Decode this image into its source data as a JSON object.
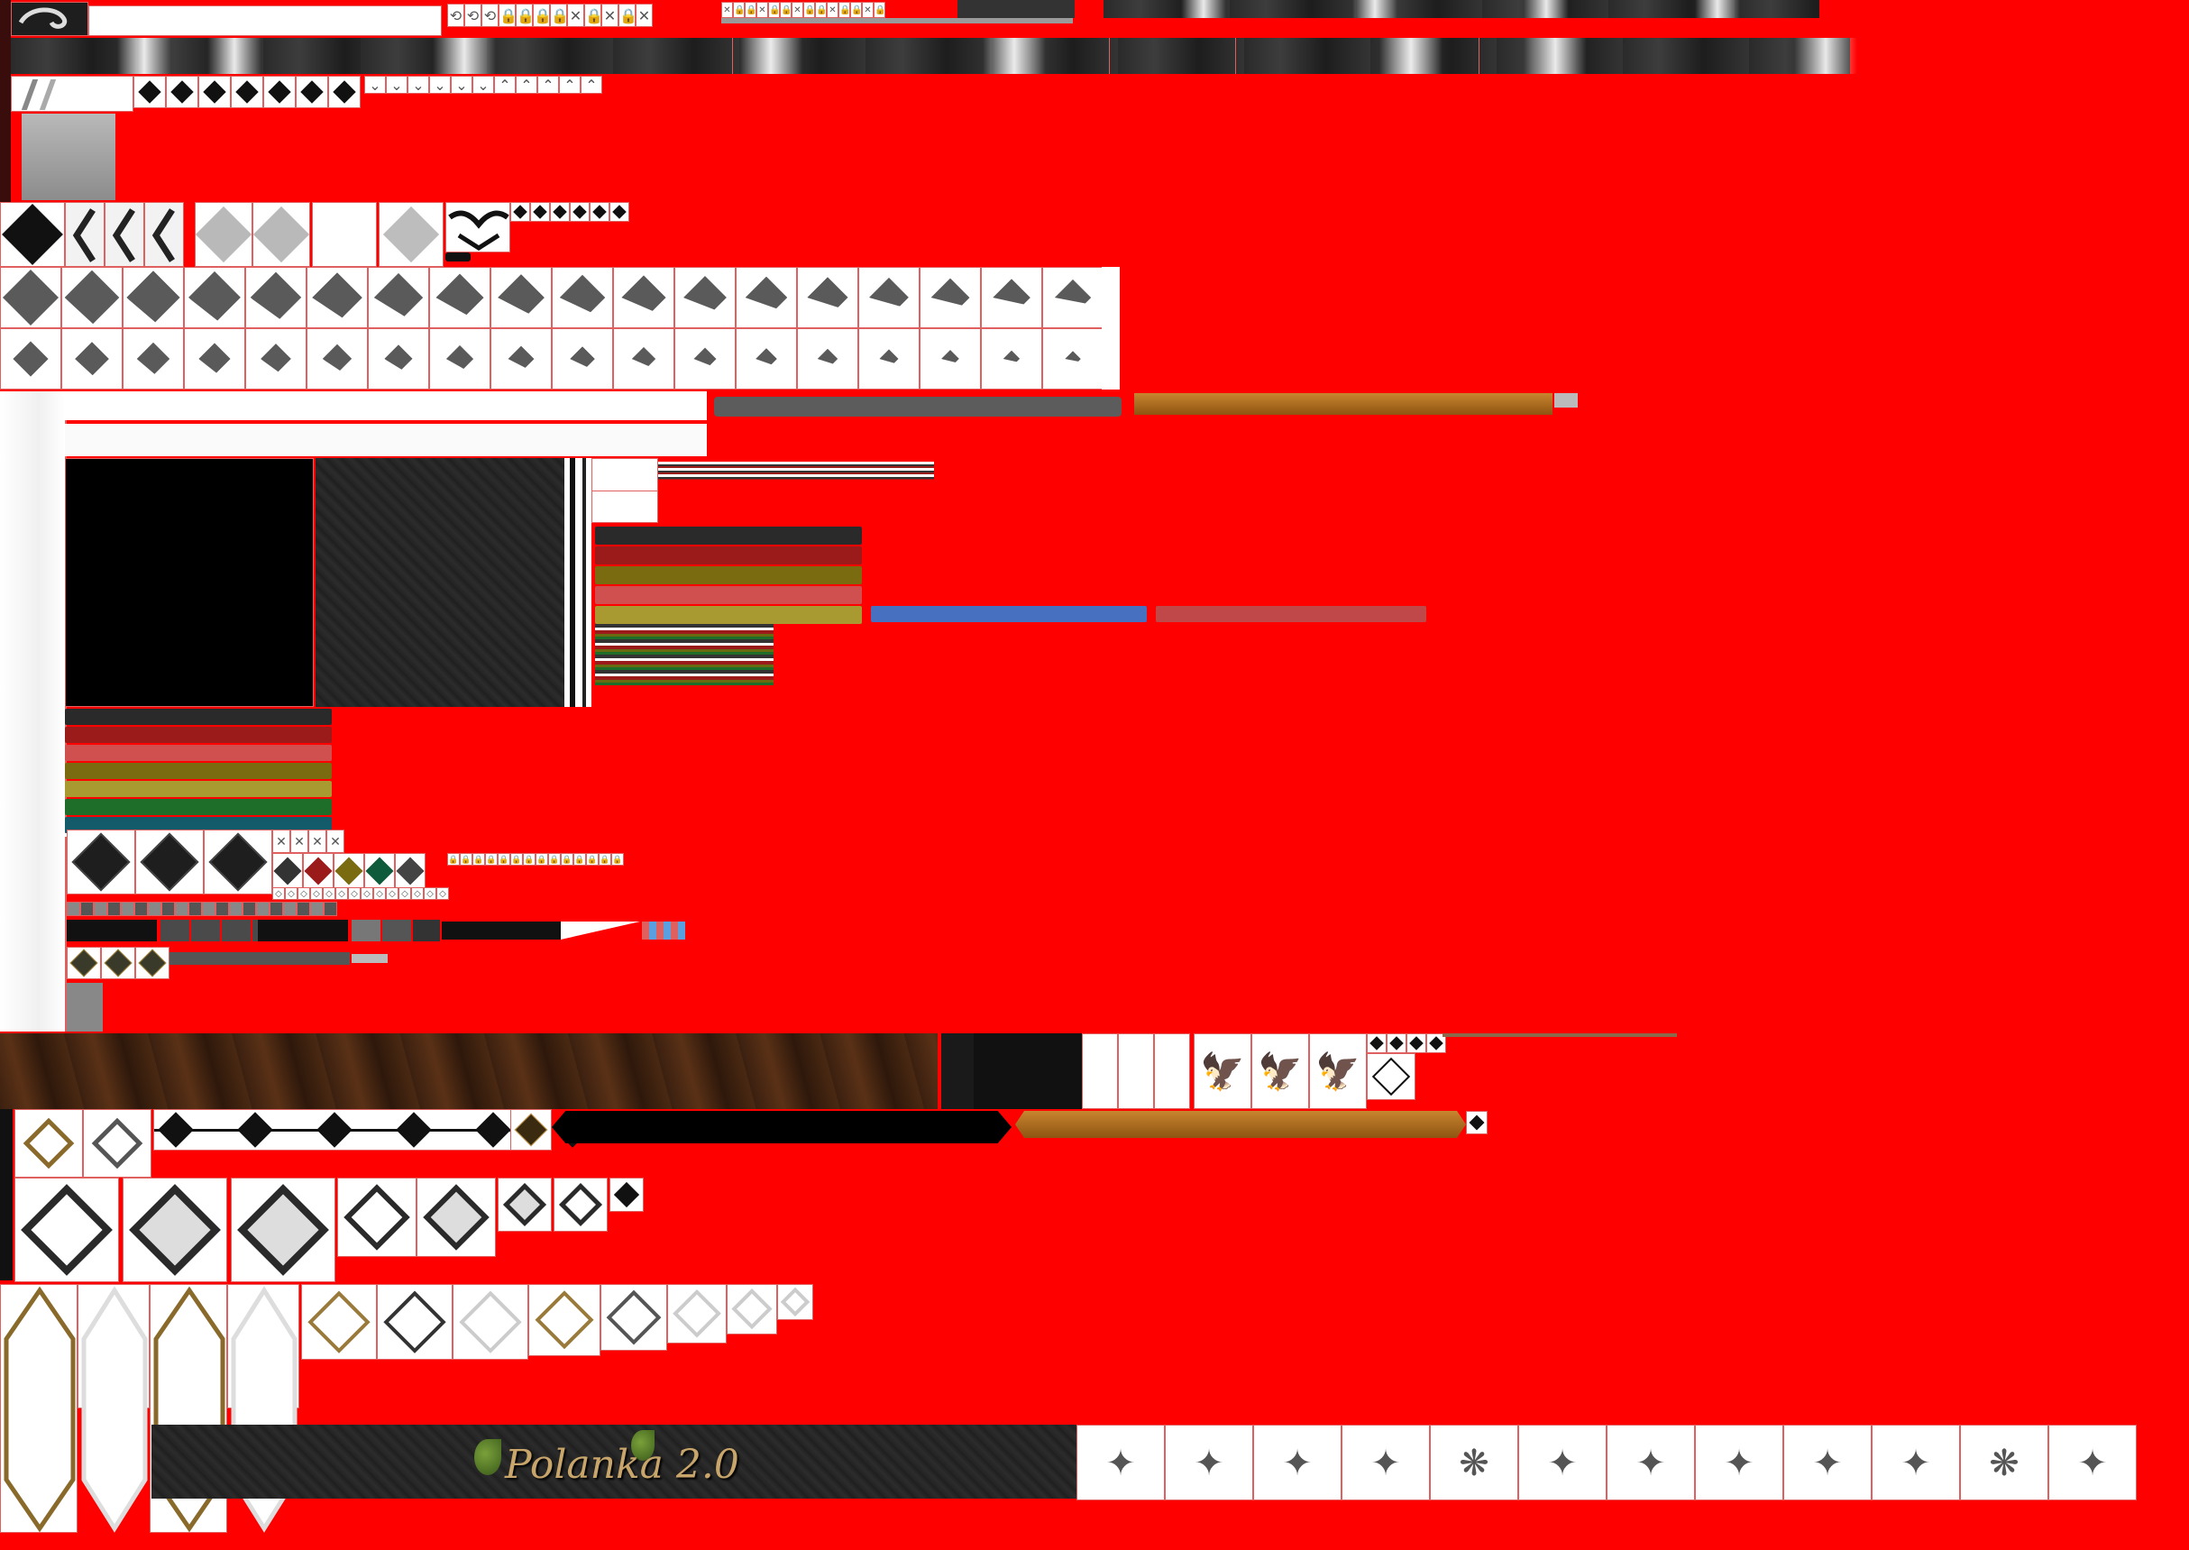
{
  "atlas": {
    "background": "#ff0000",
    "cell_line": "#e06060"
  },
  "banner": {
    "title": "Polanka 2.0",
    "leaf_icon": "leaf-icon"
  },
  "palette": {
    "dark": "#2a2a2a",
    "red": "#9b1b1b",
    "olive": "#7a6a10",
    "salmon": "#d05050",
    "mustard": "#a89a30",
    "green": "#1e6e2a",
    "teal": "#135a6a",
    "blue": "#4870c0",
    "rose": "#c04848",
    "bronze": "#b06a1c",
    "gray": "#5c5c5c"
  },
  "icons": {
    "ornament": "ornament-icon",
    "lock": "lock-icon",
    "close": "close-icon",
    "diamond": "diamond-icon",
    "chevron": "chevron-icon",
    "eagle": "eagle-icon",
    "figure": "figure-icon"
  }
}
